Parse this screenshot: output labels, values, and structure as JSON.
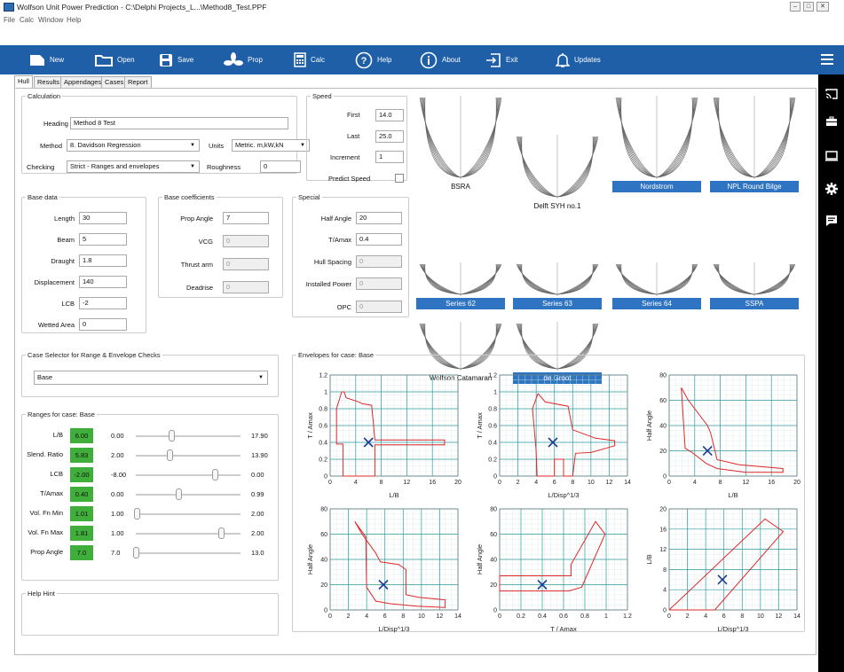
{
  "window": {
    "title": "Wolfson Unit Power Prediction - C:\\Delphi Projects_L...\\Method8_Test.PPF"
  },
  "menu": [
    "File",
    "Calc",
    "Window",
    "Help"
  ],
  "toolbar": [
    {
      "label": "New",
      "icon": "new-file-icon"
    },
    {
      "label": "Open",
      "icon": "folder-icon"
    },
    {
      "label": "Save",
      "icon": "save-icon"
    },
    {
      "label": "Prop",
      "icon": "propeller-icon"
    },
    {
      "label": "Calc",
      "icon": "calculator-icon"
    },
    {
      "label": "Help",
      "icon": "help-icon"
    },
    {
      "label": "About",
      "icon": "info-icon"
    },
    {
      "label": "Exit",
      "icon": "exit-icon"
    },
    {
      "label": "Updates",
      "icon": "bell-icon"
    }
  ],
  "side_icons": [
    "cast-icon",
    "briefcase-icon",
    "monitor-icon",
    "gear-icon",
    "message-icon"
  ],
  "tabs": [
    "Hull",
    "Results",
    "Appendages",
    "Cases",
    "Report"
  ],
  "calculation": {
    "title": "Calculation",
    "heading_label": "Heading",
    "heading_value": "Method 8 Test",
    "method_label": "Method",
    "method_value": "8. Davidson Regression",
    "units_label": "Units",
    "units_value": "Metric.  m,kW,kN",
    "checking_label": "Checking",
    "checking_value": "Strict - Ranges and envelopes",
    "roughness_label": "Roughness",
    "roughness_value": "0"
  },
  "speed": {
    "title": "Speed",
    "first_label": "First",
    "first_value": "14.0",
    "last_label": "Last",
    "last_value": "25.0",
    "increment_label": "Increment",
    "increment_value": "1",
    "predict_label": "Predict Speed"
  },
  "base_data": {
    "title": "Base data",
    "fields": [
      {
        "label": "Length",
        "value": "30"
      },
      {
        "label": "Beam",
        "value": "5"
      },
      {
        "label": "Draught",
        "value": "1.8"
      },
      {
        "label": "Displacement",
        "value": "140"
      },
      {
        "label": "LCB",
        "value": "-2"
      },
      {
        "label": "Wetted Area",
        "value": "0"
      }
    ]
  },
  "base_coeff": {
    "title": "Base coefficients",
    "fields": [
      {
        "label": "Prop Angle",
        "value": "7"
      },
      {
        "label": "VCG",
        "value": "0"
      },
      {
        "label": "Thrust arm",
        "value": "0"
      },
      {
        "label": "Deadrise",
        "value": "0"
      }
    ]
  },
  "special": {
    "title": "Special",
    "fields": [
      {
        "label": "Half Angle",
        "value": "20"
      },
      {
        "label": "T/Amax",
        "value": "0.4"
      },
      {
        "label": "Hull Spacing",
        "value": "0"
      },
      {
        "label": "Installed Power",
        "value": "0"
      },
      {
        "label": "OPC",
        "value": "0"
      }
    ]
  },
  "hull_forms": [
    "BSRA",
    "Delft SYH no.1",
    "Nordstrom",
    "NPL Round Bilge",
    "Series 62",
    "Series 63",
    "Series 64",
    "SSPA",
    "Wolfson Catamaran",
    "de Groot"
  ],
  "case_selector": {
    "title": "Case Selector for Range & Envelope Checks",
    "value": "Base"
  },
  "ranges": {
    "title": "Ranges for case: Base",
    "rows": [
      {
        "label": "L/B",
        "value": "6.00",
        "min": "0.00",
        "max": "17.90",
        "pos": 0.335
      },
      {
        "label": "Slend. Ratio",
        "value": "5.83",
        "min": "2.00",
        "max": "13.90",
        "pos": 0.322
      },
      {
        "label": "LCB",
        "value": "-2.00",
        "min": "-8.00",
        "max": "0.00",
        "pos": 0.75
      },
      {
        "label": "T/Amax",
        "value": "0.40",
        "min": "0.00",
        "max": "0.99",
        "pos": 0.404
      },
      {
        "label": "Vol. Fn Min",
        "value": "1.01",
        "min": "1.00",
        "max": "2.00",
        "pos": 0.01
      },
      {
        "label": "Vol. Fn Max",
        "value": "1.81",
        "min": "1.00",
        "max": "2.00",
        "pos": 0.81
      },
      {
        "label": "Prop Angle",
        "value": "7.0",
        "min": "7.0",
        "max": "13.0",
        "pos": 0.0
      }
    ]
  },
  "help_hint": {
    "title": "Help Hint"
  },
  "envelopes_title": "Envelopes for case: Base",
  "chart_data": [
    {
      "type": "scatter",
      "xlabel": "L/B",
      "ylabel": "T / Amax",
      "xlim": [
        0,
        20
      ],
      "ylim": [
        0,
        1.2
      ],
      "xticks": [
        0,
        4,
        8,
        12,
        16,
        20
      ],
      "yticks": [
        0,
        0.2,
        0.4,
        0.6,
        0.8,
        1,
        1.2
      ],
      "envelope": [
        [
          1.8,
          1.0
        ],
        [
          2.2,
          1.0
        ],
        [
          2.5,
          0.93
        ],
        [
          4.5,
          0.88
        ],
        [
          5.0,
          0.86
        ],
        [
          6.5,
          0.84
        ],
        [
          7.0,
          0.43
        ],
        [
          17.9,
          0.43
        ],
        [
          17.9,
          0.37
        ],
        [
          7.0,
          0.37
        ],
        [
          7.0,
          0
        ],
        [
          2.0,
          0
        ],
        [
          2.0,
          0.38
        ],
        [
          1.0,
          0.38
        ],
        [
          1.0,
          0.8
        ],
        [
          1.8,
          1.0
        ]
      ],
      "point": [
        6,
        0.4
      ]
    },
    {
      "type": "scatter",
      "xlabel": "L/Disp^1/3",
      "ylabel": "T / Amax",
      "xlim": [
        0,
        14
      ],
      "ylim": [
        0,
        1.2
      ],
      "xticks": [
        0,
        2,
        4,
        6,
        8,
        10,
        12,
        14
      ],
      "yticks": [
        0,
        0.2,
        0.4,
        0.6,
        0.8,
        1,
        1.2
      ],
      "envelope": [
        [
          4.2,
          0.98
        ],
        [
          5.0,
          0.88
        ],
        [
          7.5,
          0.83
        ],
        [
          8.0,
          0.55
        ],
        [
          10.5,
          0.45
        ],
        [
          12.6,
          0.42
        ],
        [
          12.6,
          0.36
        ],
        [
          10.0,
          0.28
        ],
        [
          8.3,
          0.27
        ],
        [
          8.0,
          0
        ],
        [
          7.0,
          0
        ],
        [
          7.0,
          0.2
        ],
        [
          6.0,
          0.2
        ],
        [
          6.0,
          0
        ],
        [
          4.1,
          0
        ],
        [
          4.0,
          0.3
        ],
        [
          3.6,
          0.8
        ],
        [
          4.2,
          0.98
        ]
      ],
      "point": [
        5.83,
        0.4
      ]
    },
    {
      "type": "scatter",
      "xlabel": "L/B",
      "ylabel": "Half Angle",
      "xlim": [
        0,
        20
      ],
      "ylim": [
        0,
        80
      ],
      "xticks": [
        0,
        4,
        8,
        12,
        16,
        20
      ],
      "yticks": [
        0,
        20,
        40,
        60,
        80
      ],
      "envelope": [
        [
          1.9,
          70
        ],
        [
          3.0,
          60
        ],
        [
          6.0,
          40
        ],
        [
          6.5,
          34
        ],
        [
          7.5,
          13
        ],
        [
          11.0,
          9
        ],
        [
          17.8,
          6
        ],
        [
          17.8,
          3
        ],
        [
          12.0,
          3
        ],
        [
          7.5,
          6
        ],
        [
          5.8,
          10
        ],
        [
          3.5,
          19
        ],
        [
          2.5,
          22
        ],
        [
          1.9,
          70
        ]
      ],
      "point": [
        6,
        20
      ]
    },
    {
      "type": "scatter",
      "xlabel": "L/Disp^1/3",
      "ylabel": "Half Angle",
      "xlim": [
        0,
        14
      ],
      "ylim": [
        0,
        80
      ],
      "xticks": [
        0,
        2,
        4,
        6,
        8,
        10,
        12,
        14
      ],
      "yticks": [
        0,
        20,
        40,
        60,
        80
      ],
      "envelope": [
        [
          2.7,
          70
        ],
        [
          3.5,
          60
        ],
        [
          5.0,
          45
        ],
        [
          5.5,
          38
        ],
        [
          7.5,
          36
        ],
        [
          8.3,
          32
        ],
        [
          8.3,
          12
        ],
        [
          9.7,
          10
        ],
        [
          12.6,
          8
        ],
        [
          12.6,
          2
        ],
        [
          9.5,
          3
        ],
        [
          6.5,
          5
        ],
        [
          5.0,
          7
        ],
        [
          4.0,
          18
        ],
        [
          3.9,
          58
        ],
        [
          2.7,
          70
        ]
      ],
      "point": [
        5.83,
        20
      ]
    },
    {
      "type": "scatter",
      "xlabel": "T / Amax",
      "ylabel": "Half Angle",
      "xlim": [
        0,
        1.2
      ],
      "ylim": [
        0,
        80
      ],
      "xticks": [
        0,
        0.2,
        0.4,
        0.6,
        0.8,
        1,
        1.2
      ],
      "yticks": [
        0,
        20,
        40,
        60,
        80
      ],
      "envelope": [
        [
          0,
          27
        ],
        [
          0.67,
          27
        ],
        [
          0.67,
          36
        ],
        [
          0.9,
          70
        ],
        [
          0.99,
          60
        ],
        [
          0.77,
          18
        ],
        [
          0.65,
          15
        ],
        [
          0,
          15
        ],
        [
          0,
          27
        ]
      ],
      "point": [
        0.4,
        20
      ]
    },
    {
      "type": "scatter",
      "xlabel": "L/Disp^1/3",
      "ylabel": "L/B",
      "xlim": [
        0,
        14
      ],
      "ylim": [
        0,
        20
      ],
      "xticks": [
        0,
        2,
        4,
        6,
        8,
        10,
        12,
        14
      ],
      "yticks": [
        0,
        4,
        8,
        12,
        16,
        20
      ],
      "envelope": [
        [
          0,
          0
        ],
        [
          4.0,
          0
        ],
        [
          5.0,
          0
        ],
        [
          12.5,
          15.5
        ],
        [
          10.5,
          18
        ],
        [
          0,
          0
        ]
      ],
      "point": [
        5.83,
        6
      ]
    }
  ]
}
